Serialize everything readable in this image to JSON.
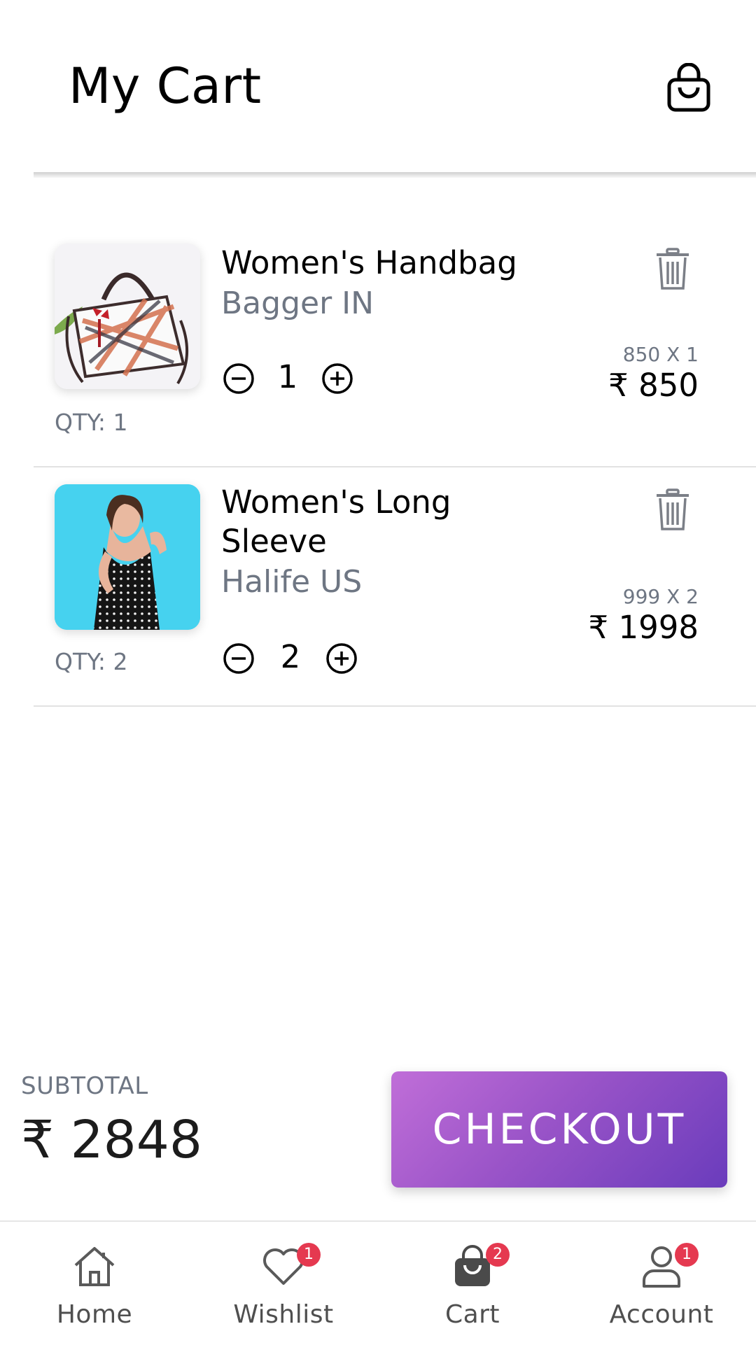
{
  "header": {
    "title": "My Cart"
  },
  "cart_items": [
    {
      "name": "Women's Handbag",
      "brand": "Bagger IN",
      "qty_label": "QTY: 1",
      "qty": "1",
      "unit_calc": "850 X 1",
      "line_total": "₹ 850"
    },
    {
      "name": "Women's Long Sleeve",
      "brand": "Halife US",
      "qty_label": "QTY: 2",
      "qty": "2",
      "unit_calc": "999 X 2",
      "line_total": "₹ 1998"
    }
  ],
  "summary": {
    "subtotal_label": "SUBTOTAL",
    "subtotal_value": "₹ 2848",
    "checkout_label": "CHECKOUT"
  },
  "nav": {
    "items": [
      {
        "label": "Home",
        "icon": "home-icon"
      },
      {
        "label": "Wishlist",
        "icon": "heart-icon",
        "badge": "1"
      },
      {
        "label": "Cart",
        "icon": "shopping-bag-icon",
        "badge": "2"
      },
      {
        "label": "Account",
        "icon": "user-icon",
        "badge": "1"
      }
    ]
  },
  "colors": {
    "accent_start": "#c06ed8",
    "accent_end": "#6a3cbc",
    "badge": "#e53950",
    "secondary_text": "#6e7683"
  }
}
